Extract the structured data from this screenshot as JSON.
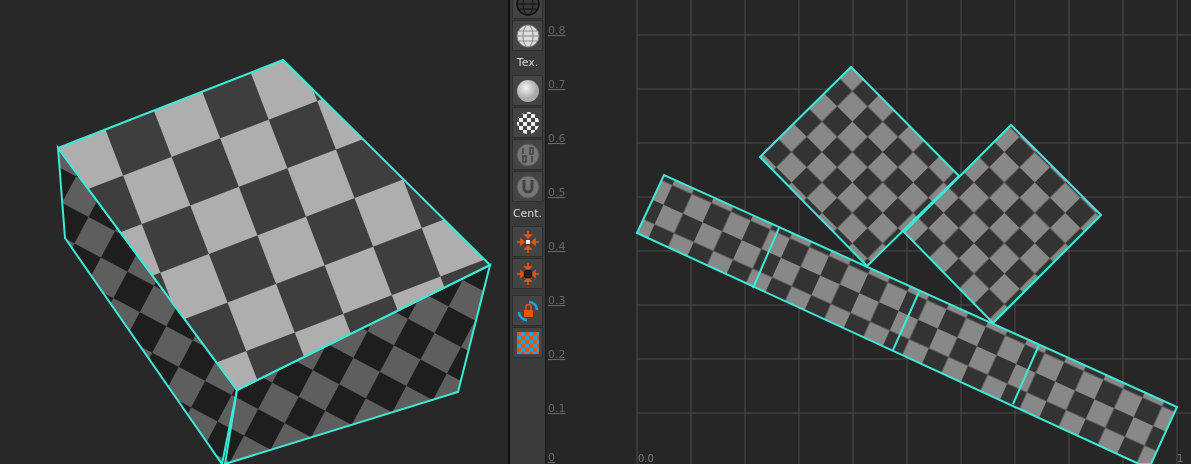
{
  "toolbar": [
    {
      "kind": "button"
    },
    {
      "kind": "button"
    },
    {
      "kind": "label",
      "text": "Tex."
    },
    {
      "kind": "button"
    },
    {
      "kind": "button"
    },
    {
      "kind": "button"
    },
    {
      "kind": "button"
    },
    {
      "kind": "label",
      "text": "Cent."
    },
    {
      "kind": "button"
    },
    {
      "kind": "button"
    },
    {
      "kind": "gap"
    },
    {
      "kind": "button"
    },
    {
      "kind": "button"
    }
  ],
  "uv_editor": {
    "v_ticks": [
      "0.8",
      "0.7",
      "0.6",
      "0.5",
      "0.4",
      "0.3",
      "0.2",
      "0.1",
      "0"
    ],
    "u_ticks": [
      "0.0",
      "1"
    ]
  }
}
